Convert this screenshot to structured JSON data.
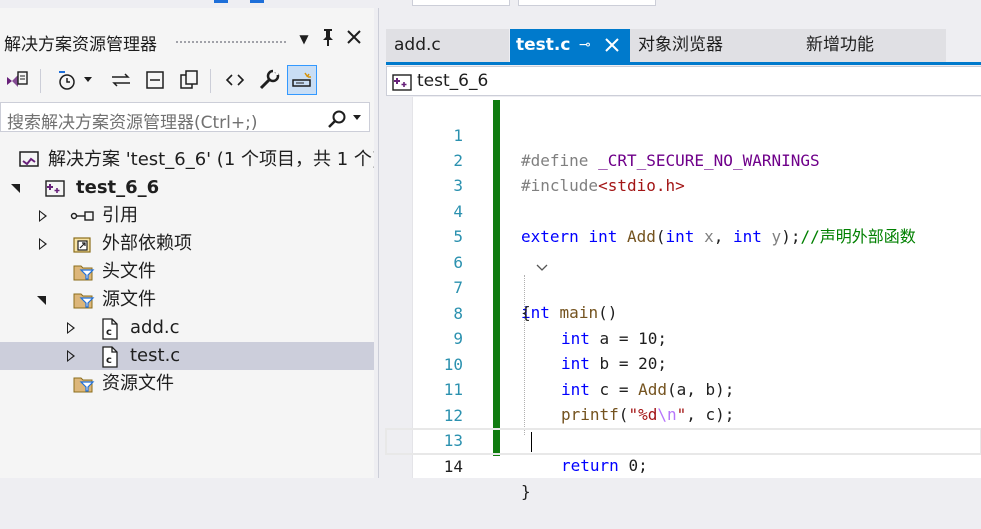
{
  "solution_explorer": {
    "title": "解决方案资源管理器",
    "search_placeholder": "搜索解决方案资源管理器(Ctrl+;)",
    "tree": [
      {
        "label": "解决方案 'test_6_6' (1 个项目，共 1 个)",
        "icon": "solution-icon",
        "expander": "none"
      },
      {
        "label": "test_6_6",
        "icon": "cpp-project-icon",
        "expander": "expanded",
        "bold": true
      },
      {
        "label": "引用",
        "icon": "references-icon",
        "expander": "collapsed"
      },
      {
        "label": "外部依赖项",
        "icon": "external-deps-icon",
        "expander": "collapsed"
      },
      {
        "label": "头文件",
        "icon": "filter-folder-icon",
        "expander": "none"
      },
      {
        "label": "源文件",
        "icon": "filter-folder-icon",
        "expander": "expanded"
      },
      {
        "label": "add.c",
        "icon": "c-file-icon",
        "expander": "collapsed"
      },
      {
        "label": "test.c",
        "icon": "c-file-icon",
        "expander": "collapsed",
        "selected": true
      },
      {
        "label": "资源文件",
        "icon": "filter-folder-icon",
        "expander": "none"
      }
    ]
  },
  "tabs": [
    {
      "label": "add.c",
      "active": false
    },
    {
      "label": "test.c",
      "active": true
    },
    {
      "label": "对象浏览器",
      "active": false
    },
    {
      "label": "新增功能",
      "active": false
    }
  ],
  "navbar": {
    "project": "test_6_6"
  },
  "editor": {
    "line_numbers": [
      "1",
      "2",
      "3",
      "4",
      "5",
      "6",
      "7",
      "8",
      "9",
      "10",
      "11",
      "12",
      "13",
      "14"
    ],
    "line1": {
      "directive": "#define",
      "macro": "_CRT_SECURE_NO_WARNINGS"
    },
    "line2": {
      "directive": "#include",
      "header": "<stdio.h>"
    },
    "line4": {
      "kw1": "extern",
      "kw2": "int",
      "fn": "Add",
      "p1": "(",
      "kw3": "int",
      "x": "x",
      "comma": ",",
      "kw4": "int",
      "y": "y",
      "p2": ");",
      "comment": "//声明外部函数"
    },
    "line6": {
      "kw": "int",
      "fn": "main",
      "parens": "()"
    },
    "line7": {
      "brace": "{"
    },
    "line8": {
      "kw": "int",
      "rest": "a = 10;"
    },
    "line9": {
      "kw": "int",
      "rest": "b = 20;"
    },
    "line10": {
      "kw": "int",
      "rest1": "c = ",
      "fn": "Add",
      "rest2": "(a, b);"
    },
    "line11": {
      "fn": "printf",
      "p1": "(",
      "str1": "\"%d",
      "esc": "\\n",
      "str2": "\"",
      "rest": ", c);"
    },
    "line13": {
      "kw": "return",
      "rest": "0;"
    },
    "line14": {
      "brace": "}"
    }
  }
}
